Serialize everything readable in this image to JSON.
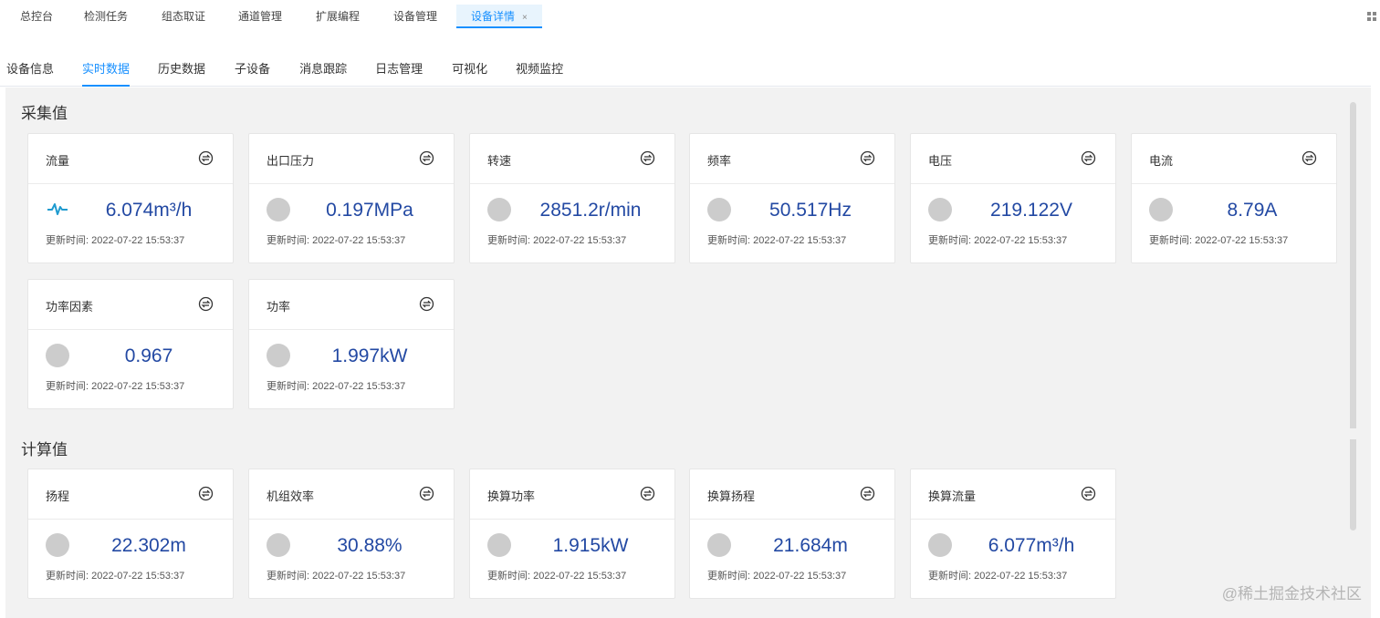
{
  "top_tabs": [
    {
      "label": "总控台"
    },
    {
      "label": "检测任务"
    },
    {
      "label": "组态取证"
    },
    {
      "label": "通道管理"
    },
    {
      "label": "扩展编程"
    },
    {
      "label": "设备管理"
    },
    {
      "label": "设备详情",
      "active": true,
      "close": "×"
    }
  ],
  "sub_tabs": [
    {
      "label": "设备信息"
    },
    {
      "label": "实时数据",
      "active": true
    },
    {
      "label": "历史数据"
    },
    {
      "label": "子设备"
    },
    {
      "label": "消息跟踪"
    },
    {
      "label": "日志管理"
    },
    {
      "label": "可视化"
    },
    {
      "label": "视频监控"
    }
  ],
  "collected": {
    "title": "采集值",
    "cards": [
      {
        "label": "流量",
        "value": "6.074m³/h",
        "time": "更新时间: 2022-07-22 15:53:37",
        "icon": "wave-icon"
      },
      {
        "label": "出口压力",
        "value": "0.197MPa",
        "time": "更新时间: 2022-07-22 15:53:37"
      },
      {
        "label": "转速",
        "value": "2851.2r/min",
        "time": "更新时间: 2022-07-22 15:53:37"
      },
      {
        "label": "频率",
        "value": "50.517Hz",
        "time": "更新时间: 2022-07-22 15:53:37"
      },
      {
        "label": "电压",
        "value": "219.122V",
        "time": "更新时间: 2022-07-22 15:53:37"
      },
      {
        "label": "电流",
        "value": "8.79A",
        "time": "更新时间: 2022-07-22 15:53:37"
      },
      {
        "label": "功率因素",
        "value": "0.967",
        "time": "更新时间: 2022-07-22 15:53:37"
      },
      {
        "label": "功率",
        "value": "1.997kW",
        "time": "更新时间: 2022-07-22 15:53:37"
      }
    ]
  },
  "computed": {
    "title": "计算值",
    "cards": [
      {
        "label": "扬程",
        "value": "22.302m",
        "time": "更新时间: 2022-07-22 15:53:37"
      },
      {
        "label": "机组效率",
        "value": "30.88%",
        "time": "更新时间: 2022-07-22 15:53:37"
      },
      {
        "label": "换算功率",
        "value": "1.915kW",
        "time": "更新时间: 2022-07-22 15:53:37"
      },
      {
        "label": "换算扬程",
        "value": "21.684m",
        "time": "更新时间: 2022-07-22 15:53:37"
      },
      {
        "label": "换算流量",
        "value": "6.077m³/h",
        "time": "更新时间: 2022-07-22 15:53:37"
      }
    ]
  },
  "watermark": "@稀土掘金技术社区",
  "colors": {
    "accent": "#1890ff",
    "value": "#2349a3",
    "panel_bg": "#f2f2f2"
  }
}
